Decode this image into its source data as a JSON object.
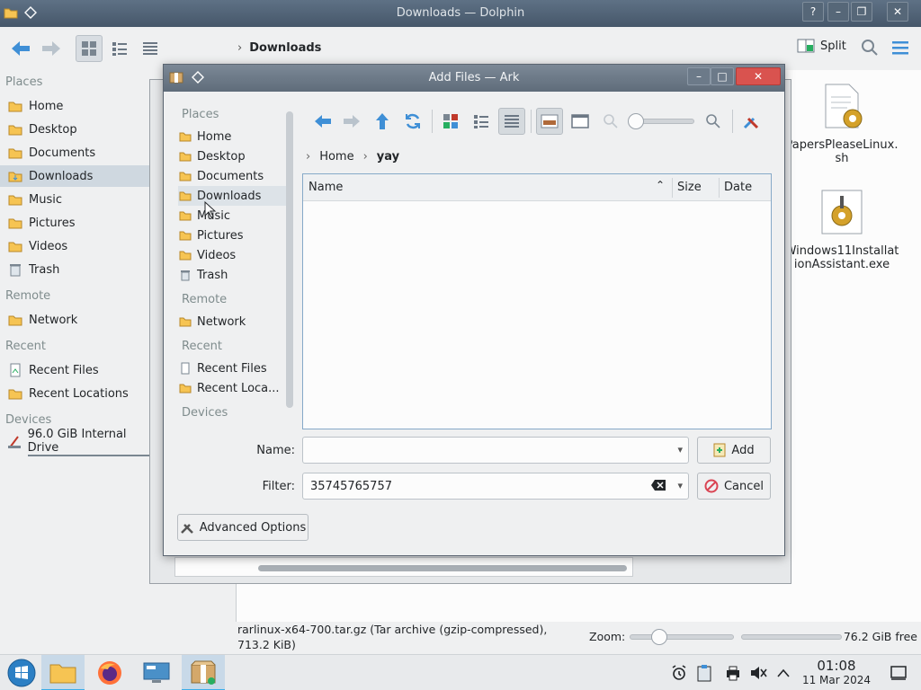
{
  "dolphin": {
    "title": "Downloads — Dolphin",
    "breadcrumb": "Downloads",
    "split_label": "Split",
    "places": {
      "sections": [
        "Places",
        "Remote",
        "Recent",
        "Devices"
      ],
      "items": [
        {
          "label": "Home"
        },
        {
          "label": "Desktop"
        },
        {
          "label": "Documents"
        },
        {
          "label": "Downloads"
        },
        {
          "label": "Music"
        },
        {
          "label": "Pictures"
        },
        {
          "label": "Videos"
        },
        {
          "label": "Trash"
        },
        {
          "label": "Network"
        },
        {
          "label": "Recent Files"
        },
        {
          "label": "Recent Locations"
        },
        {
          "label": "96.0 GiB Internal Drive"
        }
      ]
    },
    "files": [
      {
        "name": "PapersPleaseLinux.sh"
      },
      {
        "name": "Windows11InstallationAssistant.exe"
      }
    ],
    "status_text": "rarlinux-x64-700.tar.gz (Tar archive (gzip-compressed), 713.2 KiB)",
    "zoom_label": "Zoom:",
    "free_space": "76.2 GiB free"
  },
  "ark": {
    "title": "Add Files — Ark",
    "places": {
      "sections": [
        "Places",
        "Remote",
        "Recent",
        "Devices"
      ],
      "items": [
        {
          "label": "Home"
        },
        {
          "label": "Desktop"
        },
        {
          "label": "Documents"
        },
        {
          "label": "Downloads"
        },
        {
          "label": "Music"
        },
        {
          "label": "Pictures"
        },
        {
          "label": "Videos"
        },
        {
          "label": "Trash"
        },
        {
          "label": "Network"
        },
        {
          "label": "Recent Files"
        },
        {
          "label": "Recent Loca..."
        }
      ]
    },
    "breadcrumb": [
      "Home",
      "yay"
    ],
    "columns": [
      "Name",
      "Size",
      "Date"
    ],
    "name_label": "Name:",
    "name_value": "",
    "filter_label": "Filter:",
    "filter_value": "35745765757",
    "add_label": "Add",
    "cancel_label": "Cancel",
    "advanced_label": "Advanced Options"
  },
  "taskbar": {
    "time": "01:08",
    "date": "11 Mar 2024"
  },
  "colors": {
    "accent": "#3daee9",
    "folder": "#f6c453",
    "titlebar": "#5e7185"
  }
}
